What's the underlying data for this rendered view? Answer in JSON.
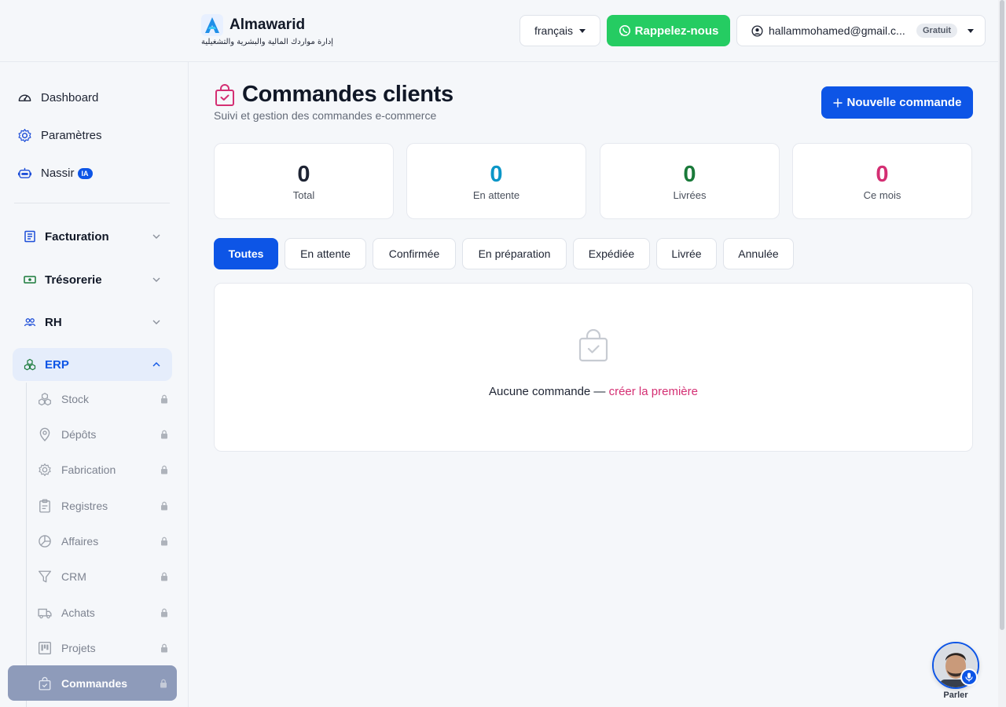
{
  "brand": {
    "name": "Almawarid",
    "tagline": "إدارة مواردك المالية والبشرية والتشغيلية"
  },
  "header": {
    "language": "français",
    "callback_label": "Rappelez-nous",
    "user_email": "hallammohamed@gmail.c...",
    "plan": "Gratuit"
  },
  "sidebar": {
    "links": [
      {
        "label": "Dashboard",
        "icon": "gauge-icon"
      },
      {
        "label": "Paramètres",
        "icon": "gear-icon"
      },
      {
        "label": "Nassir",
        "icon": "robot-icon",
        "badge": "IA"
      }
    ],
    "groups": [
      {
        "label": "Facturation",
        "icon": "invoice-icon",
        "expanded": false
      },
      {
        "label": "Trésorerie",
        "icon": "cash-icon",
        "expanded": false
      },
      {
        "label": "RH",
        "icon": "users-icon",
        "expanded": false
      },
      {
        "label": "ERP",
        "icon": "cubes-icon",
        "expanded": true
      }
    ],
    "erp_items": [
      {
        "label": "Stock",
        "icon": "cubes-icon",
        "locked": true
      },
      {
        "label": "Dépôts",
        "icon": "map-pin-icon",
        "locked": true
      },
      {
        "label": "Fabrication",
        "icon": "gear-icon",
        "locked": true
      },
      {
        "label": "Registres",
        "icon": "clipboard-icon",
        "locked": true
      },
      {
        "label": "Affaires",
        "icon": "pie-chart-icon",
        "locked": true
      },
      {
        "label": "CRM",
        "icon": "funnel-icon",
        "locked": true
      },
      {
        "label": "Achats",
        "icon": "truck-icon",
        "locked": true
      },
      {
        "label": "Projets",
        "icon": "kanban-icon",
        "locked": true
      },
      {
        "label": "Commandes",
        "icon": "shopping-bag-icon",
        "locked": true,
        "active": true
      }
    ]
  },
  "page": {
    "title": "Commandes clients",
    "subtitle": "Suivi et gestion des commandes e-commerce",
    "new_button": "Nouvelle commande"
  },
  "stats": [
    {
      "value": "0",
      "label": "Total",
      "color": "#1e2433"
    },
    {
      "value": "0",
      "label": "En attente",
      "color": "#0b96c7"
    },
    {
      "value": "0",
      "label": "Livrées",
      "color": "#1a7a3a"
    },
    {
      "value": "0",
      "label": "Ce mois",
      "color": "#d42f73"
    }
  ],
  "tabs": [
    {
      "label": "Toutes",
      "active": true
    },
    {
      "label": "En attente"
    },
    {
      "label": "Confirmée"
    },
    {
      "label": "En préparation"
    },
    {
      "label": "Expédiée"
    },
    {
      "label": "Livrée"
    },
    {
      "label": "Annulée"
    }
  ],
  "empty_state": {
    "message": "Aucune commande — ",
    "link": "créer la première"
  },
  "voice_widget": {
    "label": "Parler"
  },
  "colors": {
    "primary": "#0d55e6",
    "whatsapp": "#25cc62",
    "accent_pink": "#d42f73"
  }
}
